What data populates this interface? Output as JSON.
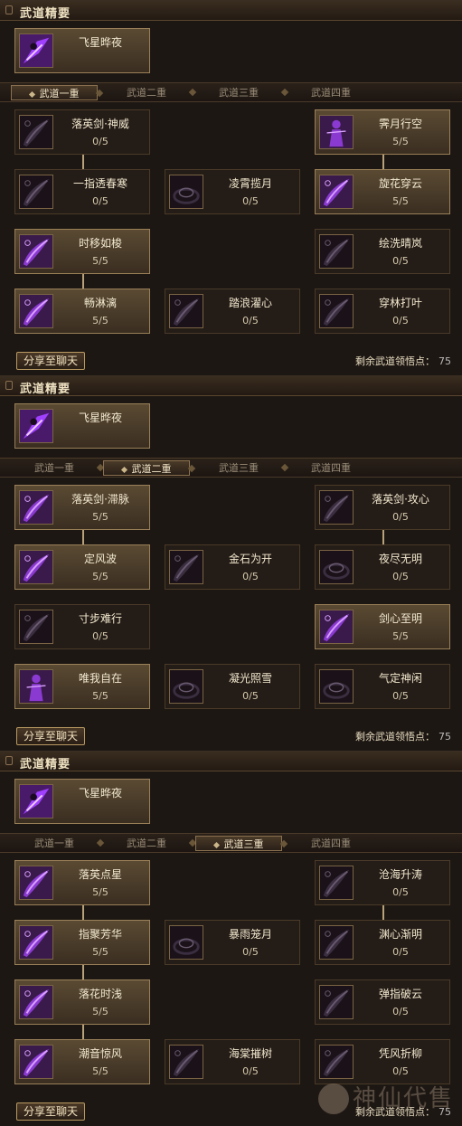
{
  "panels": [
    {
      "header": {
        "title": "武道精要"
      },
      "seal": {
        "name": "飞星晔夜",
        "icon": "night-star-skill-icon"
      },
      "tabs": [
        {
          "label": "武道一重",
          "active": true
        },
        {
          "label": "武道二重",
          "active": false
        },
        {
          "label": "武道三重",
          "active": false
        },
        {
          "label": "武道四重",
          "active": false
        }
      ],
      "rows": [
        [
          {
            "name": "落英剑·神威",
            "level": "0/5",
            "lit": false,
            "icon": "sword-slash-icon"
          },
          null,
          {
            "name": "霁月行空",
            "level": "5/5",
            "lit": true,
            "icon": "shadow-figure-icon"
          }
        ],
        [
          {
            "name": "一指透春寒",
            "level": "0/5",
            "lit": false,
            "icon": "sword-slash-icon"
          },
          {
            "name": "凌霄揽月",
            "level": "0/5",
            "lit": false,
            "icon": "swirl-icon"
          },
          {
            "name": "旋花穿云",
            "level": "5/5",
            "lit": true,
            "icon": "sword-slash-icon"
          }
        ],
        [
          {
            "name": "时移如梭",
            "level": "5/5",
            "lit": true,
            "icon": "sword-slash-icon"
          },
          null,
          {
            "name": "绘洗晴岚",
            "level": "0/5",
            "lit": false,
            "icon": "sword-slash-icon"
          }
        ],
        [
          {
            "name": "畅淋漓",
            "level": "5/5",
            "lit": true,
            "icon": "sword-slash-icon"
          },
          {
            "name": "踏浪濯心",
            "level": "0/5",
            "lit": false,
            "icon": "sword-slash-icon"
          },
          {
            "name": "穿林打叶",
            "level": "0/5",
            "lit": false,
            "icon": "sword-slash-icon"
          }
        ]
      ],
      "connectors": [
        [
          0,
          0
        ],
        [
          2,
          0
        ],
        [
          0,
          2
        ]
      ],
      "share_label": "分享至聊天",
      "remaining_label": "剩余武道领悟点：",
      "remaining_value": "75"
    },
    {
      "header": {
        "title": "武道精要"
      },
      "seal": {
        "name": "飞星晔夜",
        "icon": "night-star-skill-icon"
      },
      "tabs": [
        {
          "label": "武道一重",
          "active": false
        },
        {
          "label": "武道二重",
          "active": true
        },
        {
          "label": "武道三重",
          "active": false
        },
        {
          "label": "武道四重",
          "active": false
        }
      ],
      "rows": [
        [
          {
            "name": "落英剑·滞脉",
            "level": "5/5",
            "lit": true,
            "icon": "sword-slash-icon"
          },
          null,
          {
            "name": "落英剑·攻心",
            "level": "0/5",
            "lit": false,
            "icon": "sword-slash-icon"
          }
        ],
        [
          {
            "name": "定风波",
            "level": "5/5",
            "lit": true,
            "icon": "sword-slash-icon"
          },
          {
            "name": "金石为开",
            "level": "0/5",
            "lit": false,
            "icon": "sword-slash-icon"
          },
          {
            "name": "夜尽无明",
            "level": "0/5",
            "lit": false,
            "icon": "swirl-icon"
          }
        ],
        [
          {
            "name": "寸步难行",
            "level": "0/5",
            "lit": false,
            "icon": "sword-slash-icon"
          },
          null,
          {
            "name": "剑心至明",
            "level": "5/5",
            "lit": true,
            "icon": "sword-slash-icon"
          }
        ],
        [
          {
            "name": "唯我自在",
            "level": "5/5",
            "lit": true,
            "icon": "shadow-figure-icon"
          },
          {
            "name": "凝光照雪",
            "level": "0/5",
            "lit": false,
            "icon": "swirl-icon"
          },
          {
            "name": "气定神闲",
            "level": "0/5",
            "lit": false,
            "icon": "swirl-icon"
          }
        ]
      ],
      "connectors": [
        [
          0,
          0
        ],
        [
          0,
          2
        ]
      ],
      "share_label": "分享至聊天",
      "remaining_label": "剩余武道领悟点：",
      "remaining_value": "75"
    },
    {
      "header": {
        "title": "武道精要"
      },
      "seal": {
        "name": "飞星晔夜",
        "icon": "night-star-skill-icon"
      },
      "tabs": [
        {
          "label": "武道一重",
          "active": false
        },
        {
          "label": "武道二重",
          "active": false
        },
        {
          "label": "武道三重",
          "active": true
        },
        {
          "label": "武道四重",
          "active": false
        }
      ],
      "rows": [
        [
          {
            "name": "落英点星",
            "level": "5/5",
            "lit": true,
            "icon": "sword-slash-icon"
          },
          null,
          {
            "name": "沧海升涛",
            "level": "0/5",
            "lit": false,
            "icon": "sword-slash-icon"
          }
        ],
        [
          {
            "name": "指聚芳华",
            "level": "5/5",
            "lit": true,
            "icon": "sword-slash-icon"
          },
          {
            "name": "暴雨笼月",
            "level": "0/5",
            "lit": false,
            "icon": "swirl-icon"
          },
          {
            "name": "渊心渐明",
            "level": "0/5",
            "lit": false,
            "icon": "sword-slash-icon"
          }
        ],
        [
          {
            "name": "落花时浅",
            "level": "5/5",
            "lit": true,
            "icon": "sword-slash-icon"
          },
          null,
          {
            "name": "弹指破云",
            "level": "0/5",
            "lit": false,
            "icon": "sword-slash-icon"
          }
        ],
        [
          {
            "name": "潮音惊风",
            "level": "5/5",
            "lit": true,
            "icon": "sword-slash-icon"
          },
          {
            "name": "海棠摧树",
            "level": "0/5",
            "lit": false,
            "icon": "sword-slash-icon"
          },
          {
            "name": "凭风折柳",
            "level": "0/5",
            "lit": false,
            "icon": "sword-slash-icon"
          }
        ]
      ],
      "connectors": [
        [
          0,
          0
        ],
        [
          1,
          0
        ],
        [
          2,
          0
        ],
        [
          0,
          2
        ]
      ],
      "share_label": "分享至聊天",
      "remaining_label": "剩余武道领悟点：",
      "remaining_value": "75"
    }
  ],
  "watermark": {
    "text": "神仙代售"
  }
}
